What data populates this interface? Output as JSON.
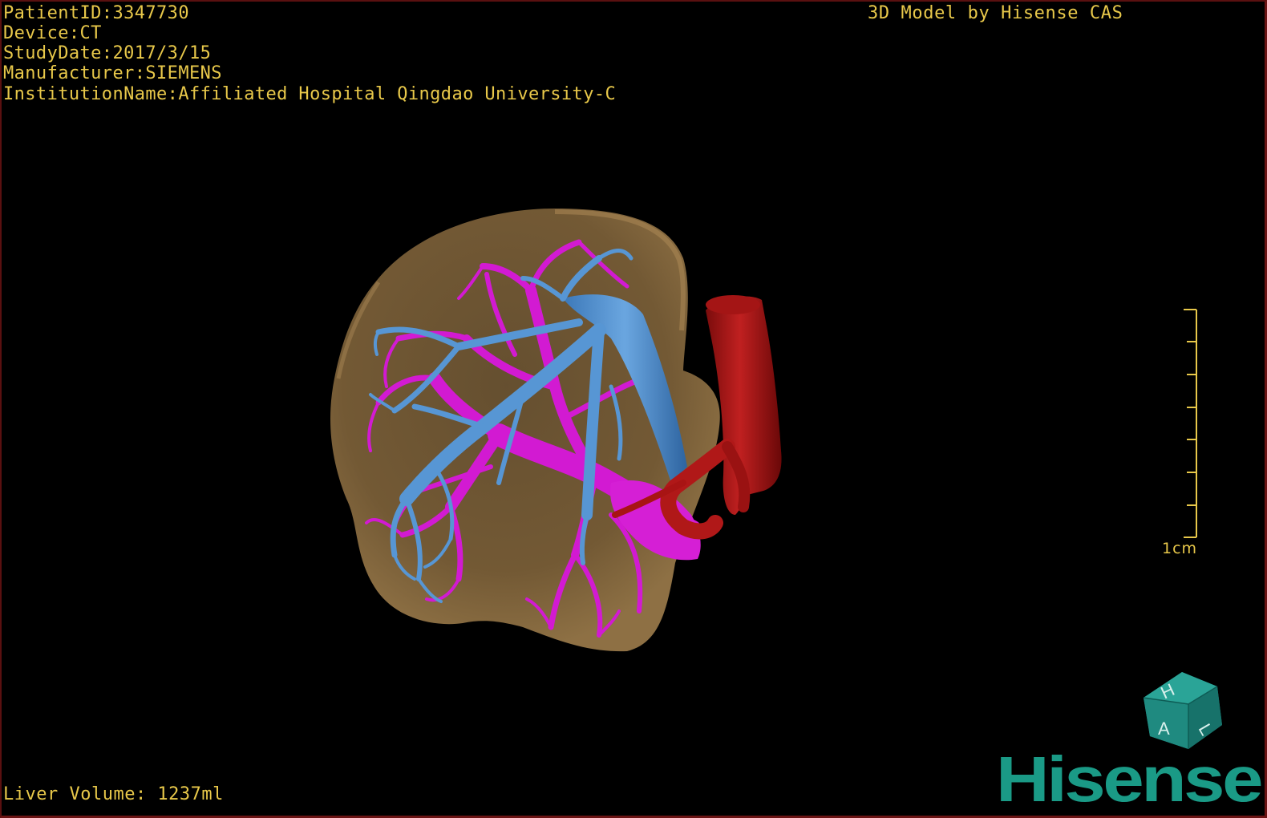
{
  "header": {
    "patient_id": "PatientID:3347730",
    "device": "Device:CT",
    "study_date": "StudyDate:2017/3/15",
    "manufacturer": "Manufacturer:SIEMENS",
    "institution": "InstitutionName:Affiliated Hospital Qingdao University-C"
  },
  "watermark": "3D Model by Hisense CAS",
  "footer": {
    "liver_volume": "Liver Volume: 1237ml"
  },
  "scale_bar": {
    "label": "1cm"
  },
  "orientation_cube": {
    "face_labels": [
      "H",
      "A",
      "L"
    ]
  },
  "brand": {
    "name": "Hisense",
    "color": "#1a9a86"
  },
  "colors": {
    "text": "#e8c84a",
    "liver": "#8a6b3e",
    "portal_vein": "#d21ad2",
    "hepatic_vein": "#4f8fcc",
    "aorta": "#b01818",
    "cube": "#1f8a80"
  },
  "structures": [
    "liver",
    "portal-vein",
    "hepatic-vein",
    "aorta",
    "hepatic-artery"
  ]
}
